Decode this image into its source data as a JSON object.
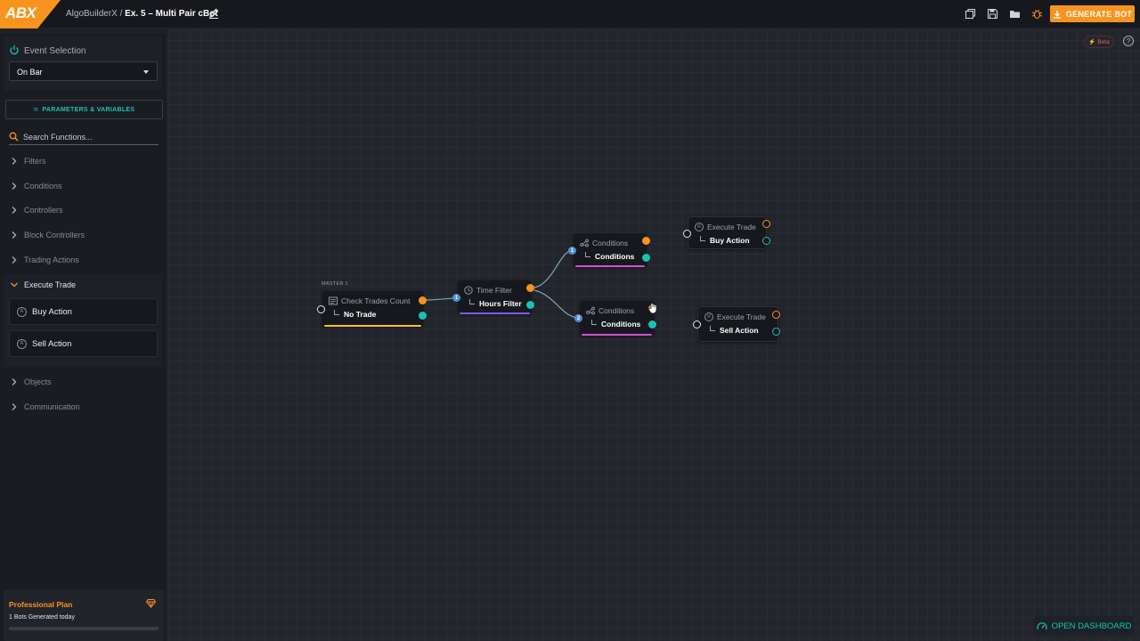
{
  "header": {
    "logo_text": "ABX",
    "app_name": "AlgoBuilderX",
    "separator": "/",
    "project_name": "Ex. 5 – Multi Pair cBot",
    "generate_label": "GENERATE BOT",
    "accent": "#f7931e"
  },
  "sidebar": {
    "event_title": "Event Selection",
    "event_value": "On Bar",
    "params_label": "PARAMETERS & VARIABLES",
    "search_placeholder": "Search Functions...",
    "categories": [
      {
        "label": "Filters"
      },
      {
        "label": "Conditions"
      },
      {
        "label": "Controllers"
      },
      {
        "label": "Block Controllers"
      },
      {
        "label": "Trading Actions"
      }
    ],
    "execute_trade": {
      "label": "Execute Trade",
      "items": [
        {
          "label": "Buy Action"
        },
        {
          "label": "Sell Action"
        }
      ]
    },
    "categories_after": [
      {
        "label": "Objects"
      },
      {
        "label": "Communication"
      }
    ],
    "plan": {
      "title": "Professional Plan",
      "usage": "1 Bots Generated today",
      "progress": 0.0
    }
  },
  "canvas": {
    "beta_label": "Beta",
    "help_label": "?",
    "master_label": "MASTER 1",
    "nodes": {
      "check": {
        "title": "Check Trades Count",
        "value": "No Trade",
        "accent": "#f5c518"
      },
      "time": {
        "title": "Time Filter",
        "value": "Hours Filter",
        "accent": "#7b5cff"
      },
      "cond1": {
        "title": "Conditions",
        "value": "Conditions",
        "accent": "#d44fd4"
      },
      "cond2": {
        "title": "Conditions",
        "value": "Conditions",
        "accent": "#d44fd4"
      },
      "buy": {
        "title": "Execute Trade",
        "value": "Buy Action"
      },
      "sell": {
        "title": "Execute Trade",
        "value": "Sell Action"
      }
    },
    "badges": {
      "b1": "1",
      "b2": "1",
      "b3": "2"
    },
    "dashboard_label": "OPEN DASHBOARD"
  }
}
